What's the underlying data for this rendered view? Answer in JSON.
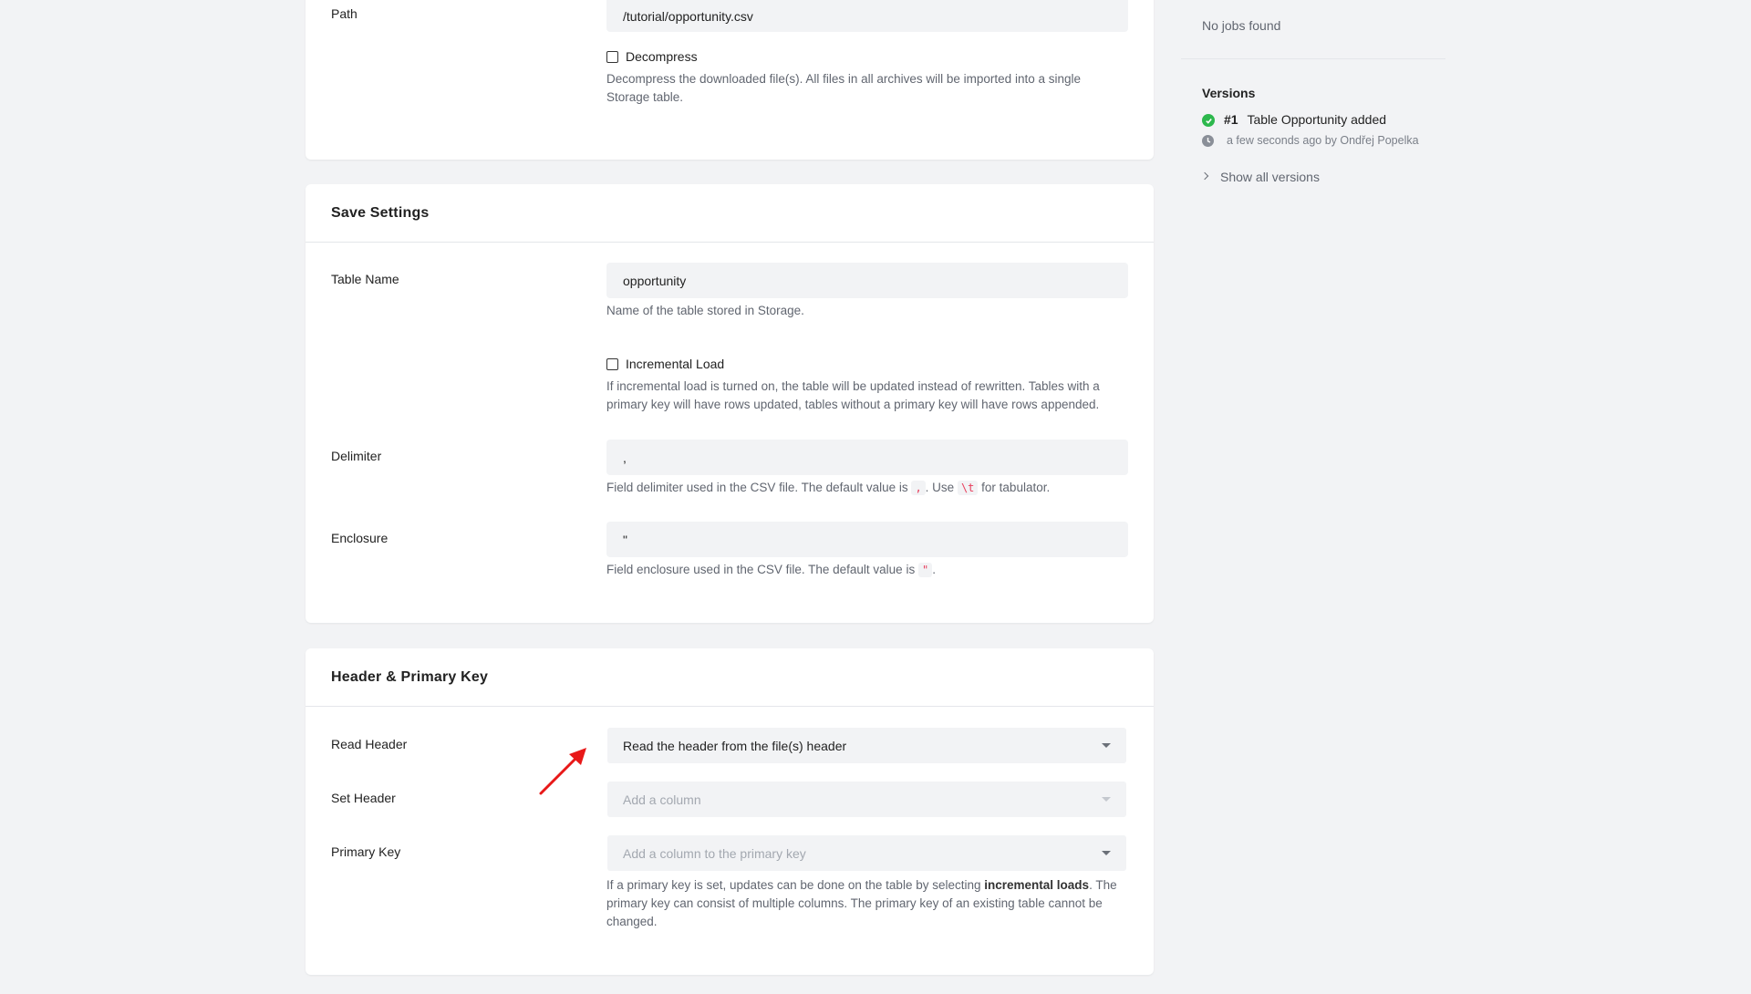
{
  "source_card": {
    "path_label": "Path",
    "path_value": "/tutorial/opportunity.csv",
    "decompress_label": "Decompress",
    "decompress_help": "Decompress the downloaded file(s). All files in all archives will be imported into a single Storage table."
  },
  "save_settings": {
    "title": "Save Settings",
    "table_name_label": "Table Name",
    "table_name_value": "opportunity",
    "table_name_help": "Name of the table stored in Storage.",
    "incremental_label": "Incremental Load",
    "incremental_help": "If incremental load is turned on, the table will be updated instead of rewritten. Tables with a primary key will have rows updated, tables without a primary key will have rows appended.",
    "delimiter_label": "Delimiter",
    "delimiter_value": ",",
    "delimiter_help_1": "Field delimiter used in the CSV file. The default value is",
    "delimiter_code_1": ",",
    "delimiter_help_2": ". Use",
    "delimiter_code_2": "\\t",
    "delimiter_help_3": "for tabulator.",
    "enclosure_label": "Enclosure",
    "enclosure_value": "\"",
    "enclosure_help_1": "Field enclosure used in the CSV file. The default value is",
    "enclosure_code": "\"",
    "enclosure_help_2": "."
  },
  "header_pk": {
    "title": "Header & Primary Key",
    "read_header_label": "Read Header",
    "read_header_value": "Read the header from the file(s) header",
    "set_header_label": "Set Header",
    "set_header_placeholder": "Add a column",
    "primary_key_label": "Primary Key",
    "primary_key_placeholder": "Add a column to the primary key",
    "pk_help_1": "If a primary key is set, updates can be done on the table by selecting",
    "pk_help_bold": "incremental loads",
    "pk_help_2": ". The primary key can consist of multiple columns. The primary key of an existing table cannot be changed."
  },
  "sidebar": {
    "last_runs_empty": "No jobs found",
    "versions_title": "Versions",
    "version_number": "#1",
    "version_desc": "Table Opportunity added",
    "version_meta": "a few seconds ago by Ondřej Popelka",
    "show_all": "Show all versions"
  },
  "colors": {
    "accent_success": "#2db84d",
    "annotation_arrow": "#e81818"
  }
}
